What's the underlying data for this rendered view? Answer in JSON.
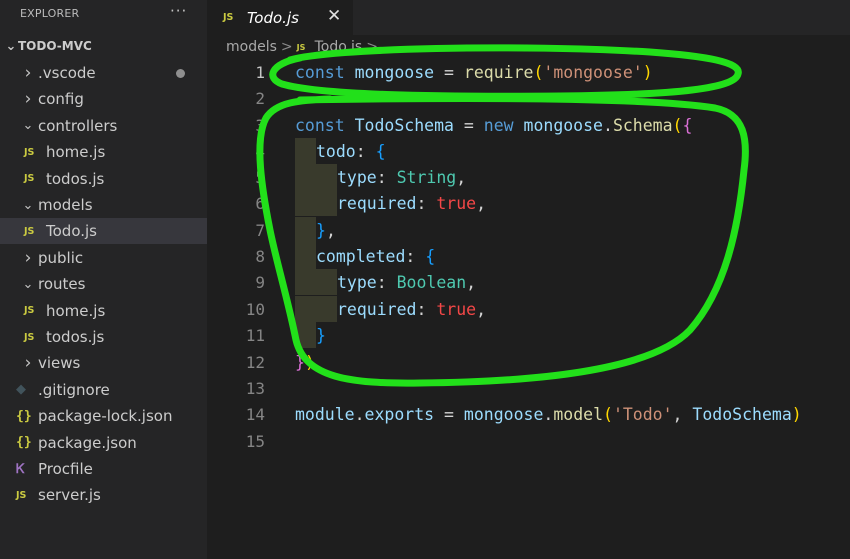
{
  "sidebar": {
    "header": "EXPLORER",
    "more": "···",
    "root": "TODO-MVC",
    "items": [
      {
        "label": ".vscode",
        "kind": "folder",
        "state": "collapsed",
        "modified": true
      },
      {
        "label": "config",
        "kind": "folder",
        "state": "collapsed"
      },
      {
        "label": "controllers",
        "kind": "folder",
        "state": "expanded"
      },
      {
        "label": "home.js",
        "kind": "js"
      },
      {
        "label": "todos.js",
        "kind": "js"
      },
      {
        "label": "models",
        "kind": "folder",
        "state": "expanded"
      },
      {
        "label": "Todo.js",
        "kind": "js",
        "active": true
      },
      {
        "label": "public",
        "kind": "folder",
        "state": "collapsed"
      },
      {
        "label": "routes",
        "kind": "folder",
        "state": "expanded"
      },
      {
        "label": "home.js",
        "kind": "js"
      },
      {
        "label": "todos.js",
        "kind": "js"
      },
      {
        "label": "views",
        "kind": "folder",
        "state": "collapsed"
      },
      {
        "label": ".gitignore",
        "kind": "git"
      },
      {
        "label": "package-lock.json",
        "kind": "json"
      },
      {
        "label": "package.json",
        "kind": "json"
      },
      {
        "label": "Procfile",
        "kind": "procfile"
      },
      {
        "label": "server.js",
        "kind": "js"
      }
    ]
  },
  "tab": {
    "badge": "JS",
    "label": "Todo.js",
    "close": "✕"
  },
  "breadcrumb": {
    "folder": "models",
    "sep": ">",
    "file": "Todo.js",
    "more": "..."
  },
  "editor": {
    "current_line": 1,
    "line_numbers": [
      "1",
      "2",
      "3",
      "4",
      "5",
      "6",
      "7",
      "8",
      "9",
      "10",
      "11",
      "12",
      "13",
      "14",
      "15"
    ]
  },
  "icons": {
    "js_badge": "JS",
    "json_badge": "{}",
    "chevron_right": "›",
    "chevron_down": "⌄"
  },
  "colors": {
    "annotation": "#22e01a",
    "accent_js": "#cbcb41"
  }
}
